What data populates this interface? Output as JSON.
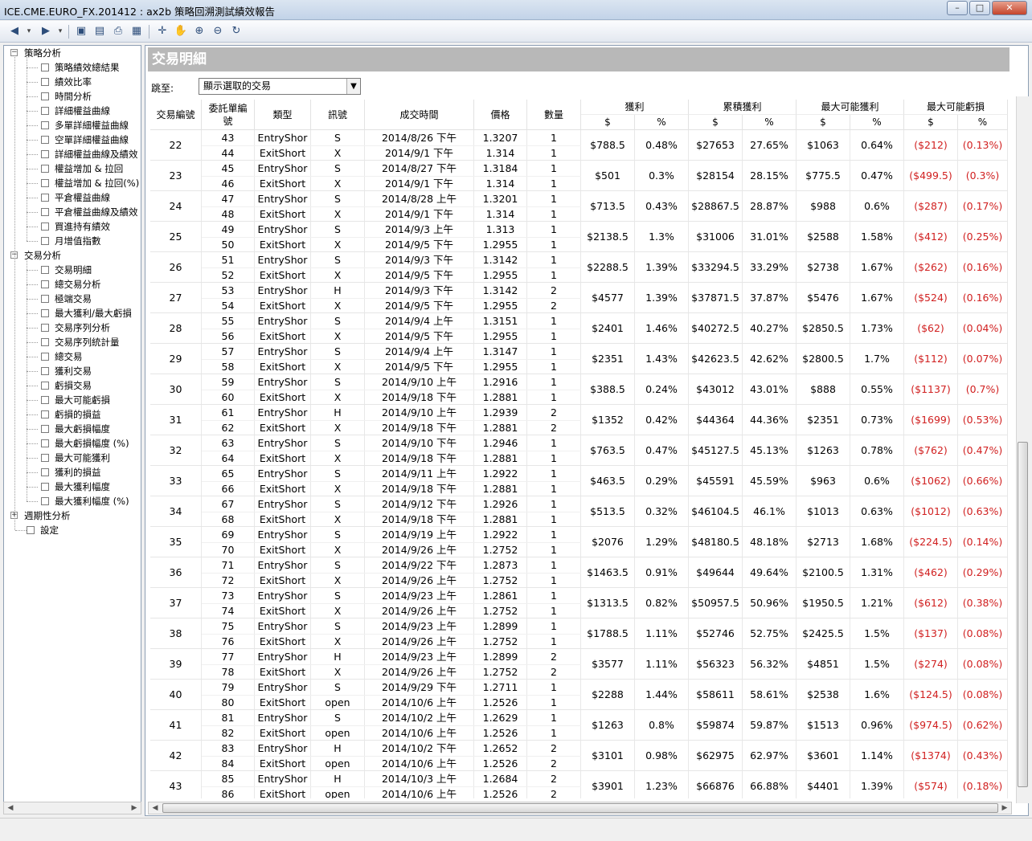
{
  "window": {
    "title": "ICE.CME.EURO_FX.201412 : ax2b 策略回溯測試績效報告",
    "minimize_glyph": "–",
    "maximize_glyph": "□",
    "close_glyph": "✕"
  },
  "toolbar": {
    "icons": [
      "back-icon",
      "dropdown-arrow-icon",
      "forward-icon",
      "dropdown-arrow-icon",
      "save-icon",
      "export-icon",
      "print-icon",
      "preview-icon",
      "crosshair-icon",
      "hand-pan-icon",
      "zoom-in-icon",
      "zoom-out-icon",
      "refresh-icon"
    ],
    "glyphs": {
      "back": "◀",
      "forward": "▶",
      "dropdown": "▾",
      "save": "▣",
      "export": "▤",
      "print": "⎙",
      "preview": "▦",
      "crosshair": "✛",
      "hand": "✋",
      "zoomin": "⊕",
      "zoomout": "⊖",
      "refresh": "↻"
    }
  },
  "tree": {
    "groups": [
      {
        "label": "策略分析",
        "toggle": "−",
        "items": [
          "策略績效總結果",
          "績效比率",
          "時間分析",
          "詳細權益曲線",
          "多單詳細權益曲線",
          "空單詳細權益曲線",
          "詳細權益曲線及績效",
          "權益增加 & 拉回",
          "權益增加 & 拉回(%)",
          "平倉權益曲線",
          "平倉權益曲線及績效",
          "買進持有績效",
          "月增值指數"
        ]
      },
      {
        "label": "交易分析",
        "toggle": "−",
        "items": [
          "交易明細",
          "總交易分析",
          "極端交易",
          "最大獲利/最大虧損",
          "交易序列分析",
          "交易序列統計量",
          "總交易",
          "獲利交易",
          "虧損交易",
          "最大可能虧損",
          "虧損的損益",
          "最大虧損幅度",
          "最大虧損幅度 (%)",
          "最大可能獲利",
          "獲利的損益",
          "最大獲利幅度",
          "最大獲利幅度 (%)"
        ]
      },
      {
        "label": "週期性分析",
        "toggle": "+",
        "items": []
      }
    ],
    "settings_label": "設定"
  },
  "main": {
    "header": "交易明細",
    "jump_label": "跳至:",
    "jump_value": "顯示選取的交易",
    "columns": {
      "trade_no": "交易編號",
      "order_no_1": "委託單編",
      "order_no_2": "號",
      "type": "類型",
      "signal": "訊號",
      "time": "成交時間",
      "price": "價格",
      "qty": "數量",
      "profit": "獲利",
      "cum_profit": "累積獲利",
      "max_profit": "最大可能獲利",
      "max_loss": "最大可能虧損",
      "dollar": "$",
      "percent": "%"
    },
    "trades": [
      {
        "no": "22",
        "e_ord": "43",
        "e_type": "EntryShor",
        "e_sig": "S",
        "e_time": "2014/8/26 下午",
        "e_price": "1.3207",
        "e_qty": "1",
        "x_ord": "44",
        "x_type": "ExitShort",
        "x_sig": "X",
        "x_time": "2014/9/1 下午",
        "x_price": "1.314",
        "x_qty": "1",
        "p": "$788.5",
        "pp": "0.48%",
        "c": "$27653",
        "cp": "27.65%",
        "mp": "$1063",
        "mpp": "0.64%",
        "ml": "($212)",
        "mlp": "(0.13%)"
      },
      {
        "no": "23",
        "e_ord": "45",
        "e_type": "EntryShor",
        "e_sig": "S",
        "e_time": "2014/8/27 下午",
        "e_price": "1.3184",
        "e_qty": "1",
        "x_ord": "46",
        "x_type": "ExitShort",
        "x_sig": "X",
        "x_time": "2014/9/1 下午",
        "x_price": "1.314",
        "x_qty": "1",
        "p": "$501",
        "pp": "0.3%",
        "c": "$28154",
        "cp": "28.15%",
        "mp": "$775.5",
        "mpp": "0.47%",
        "ml": "($499.5)",
        "mlp": "(0.3%)"
      },
      {
        "no": "24",
        "e_ord": "47",
        "e_type": "EntryShor",
        "e_sig": "S",
        "e_time": "2014/8/28 上午",
        "e_price": "1.3201",
        "e_qty": "1",
        "x_ord": "48",
        "x_type": "ExitShort",
        "x_sig": "X",
        "x_time": "2014/9/1 下午",
        "x_price": "1.314",
        "x_qty": "1",
        "p": "$713.5",
        "pp": "0.43%",
        "c": "$28867.5",
        "cp": "28.87%",
        "mp": "$988",
        "mpp": "0.6%",
        "ml": "($287)",
        "mlp": "(0.17%)"
      },
      {
        "no": "25",
        "e_ord": "49",
        "e_type": "EntryShor",
        "e_sig": "S",
        "e_time": "2014/9/3 上午",
        "e_price": "1.313",
        "e_qty": "1",
        "x_ord": "50",
        "x_type": "ExitShort",
        "x_sig": "X",
        "x_time": "2014/9/5 下午",
        "x_price": "1.2955",
        "x_qty": "1",
        "p": "$2138.5",
        "pp": "1.3%",
        "c": "$31006",
        "cp": "31.01%",
        "mp": "$2588",
        "mpp": "1.58%",
        "ml": "($412)",
        "mlp": "(0.25%)"
      },
      {
        "no": "26",
        "e_ord": "51",
        "e_type": "EntryShor",
        "e_sig": "S",
        "e_time": "2014/9/3 下午",
        "e_price": "1.3142",
        "e_qty": "1",
        "x_ord": "52",
        "x_type": "ExitShort",
        "x_sig": "X",
        "x_time": "2014/9/5 下午",
        "x_price": "1.2955",
        "x_qty": "1",
        "p": "$2288.5",
        "pp": "1.39%",
        "c": "$33294.5",
        "cp": "33.29%",
        "mp": "$2738",
        "mpp": "1.67%",
        "ml": "($262)",
        "mlp": "(0.16%)"
      },
      {
        "no": "27",
        "e_ord": "53",
        "e_type": "EntryShor",
        "e_sig": "H",
        "e_time": "2014/9/3 下午",
        "e_price": "1.3142",
        "e_qty": "2",
        "x_ord": "54",
        "x_type": "ExitShort",
        "x_sig": "X",
        "x_time": "2014/9/5 下午",
        "x_price": "1.2955",
        "x_qty": "2",
        "p": "$4577",
        "pp": "1.39%",
        "c": "$37871.5",
        "cp": "37.87%",
        "mp": "$5476",
        "mpp": "1.67%",
        "ml": "($524)",
        "mlp": "(0.16%)"
      },
      {
        "no": "28",
        "e_ord": "55",
        "e_type": "EntryShor",
        "e_sig": "S",
        "e_time": "2014/9/4 上午",
        "e_price": "1.3151",
        "e_qty": "1",
        "x_ord": "56",
        "x_type": "ExitShort",
        "x_sig": "X",
        "x_time": "2014/9/5 下午",
        "x_price": "1.2955",
        "x_qty": "1",
        "p": "$2401",
        "pp": "1.46%",
        "c": "$40272.5",
        "cp": "40.27%",
        "mp": "$2850.5",
        "mpp": "1.73%",
        "ml": "($62)",
        "mlp": "(0.04%)"
      },
      {
        "no": "29",
        "e_ord": "57",
        "e_type": "EntryShor",
        "e_sig": "S",
        "e_time": "2014/9/4 上午",
        "e_price": "1.3147",
        "e_qty": "1",
        "x_ord": "58",
        "x_type": "ExitShort",
        "x_sig": "X",
        "x_time": "2014/9/5 下午",
        "x_price": "1.2955",
        "x_qty": "1",
        "p": "$2351",
        "pp": "1.43%",
        "c": "$42623.5",
        "cp": "42.62%",
        "mp": "$2800.5",
        "mpp": "1.7%",
        "ml": "($112)",
        "mlp": "(0.07%)"
      },
      {
        "no": "30",
        "e_ord": "59",
        "e_type": "EntryShor",
        "e_sig": "S",
        "e_time": "2014/9/10 上午",
        "e_price": "1.2916",
        "e_qty": "1",
        "x_ord": "60",
        "x_type": "ExitShort",
        "x_sig": "X",
        "x_time": "2014/9/18 下午",
        "x_price": "1.2881",
        "x_qty": "1",
        "p": "$388.5",
        "pp": "0.24%",
        "c": "$43012",
        "cp": "43.01%",
        "mp": "$888",
        "mpp": "0.55%",
        "ml": "($1137)",
        "mlp": "(0.7%)"
      },
      {
        "no": "31",
        "e_ord": "61",
        "e_type": "EntryShor",
        "e_sig": "H",
        "e_time": "2014/9/10 上午",
        "e_price": "1.2939",
        "e_qty": "2",
        "x_ord": "62",
        "x_type": "ExitShort",
        "x_sig": "X",
        "x_time": "2014/9/18 下午",
        "x_price": "1.2881",
        "x_qty": "2",
        "p": "$1352",
        "pp": "0.42%",
        "c": "$44364",
        "cp": "44.36%",
        "mp": "$2351",
        "mpp": "0.73%",
        "ml": "($1699)",
        "mlp": "(0.53%)"
      },
      {
        "no": "32",
        "e_ord": "63",
        "e_type": "EntryShor",
        "e_sig": "S",
        "e_time": "2014/9/10 下午",
        "e_price": "1.2946",
        "e_qty": "1",
        "x_ord": "64",
        "x_type": "ExitShort",
        "x_sig": "X",
        "x_time": "2014/9/18 下午",
        "x_price": "1.2881",
        "x_qty": "1",
        "p": "$763.5",
        "pp": "0.47%",
        "c": "$45127.5",
        "cp": "45.13%",
        "mp": "$1263",
        "mpp": "0.78%",
        "ml": "($762)",
        "mlp": "(0.47%)"
      },
      {
        "no": "33",
        "e_ord": "65",
        "e_type": "EntryShor",
        "e_sig": "S",
        "e_time": "2014/9/11 上午",
        "e_price": "1.2922",
        "e_qty": "1",
        "x_ord": "66",
        "x_type": "ExitShort",
        "x_sig": "X",
        "x_time": "2014/9/18 下午",
        "x_price": "1.2881",
        "x_qty": "1",
        "p": "$463.5",
        "pp": "0.29%",
        "c": "$45591",
        "cp": "45.59%",
        "mp": "$963",
        "mpp": "0.6%",
        "ml": "($1062)",
        "mlp": "(0.66%)"
      },
      {
        "no": "34",
        "e_ord": "67",
        "e_type": "EntryShor",
        "e_sig": "S",
        "e_time": "2014/9/12 下午",
        "e_price": "1.2926",
        "e_qty": "1",
        "x_ord": "68",
        "x_type": "ExitShort",
        "x_sig": "X",
        "x_time": "2014/9/18 下午",
        "x_price": "1.2881",
        "x_qty": "1",
        "p": "$513.5",
        "pp": "0.32%",
        "c": "$46104.5",
        "cp": "46.1%",
        "mp": "$1013",
        "mpp": "0.63%",
        "ml": "($1012)",
        "mlp": "(0.63%)"
      },
      {
        "no": "35",
        "e_ord": "69",
        "e_type": "EntryShor",
        "e_sig": "S",
        "e_time": "2014/9/19 上午",
        "e_price": "1.2922",
        "e_qty": "1",
        "x_ord": "70",
        "x_type": "ExitShort",
        "x_sig": "X",
        "x_time": "2014/9/26 上午",
        "x_price": "1.2752",
        "x_qty": "1",
        "p": "$2076",
        "pp": "1.29%",
        "c": "$48180.5",
        "cp": "48.18%",
        "mp": "$2713",
        "mpp": "1.68%",
        "ml": "($224.5)",
        "mlp": "(0.14%)"
      },
      {
        "no": "36",
        "e_ord": "71",
        "e_type": "EntryShor",
        "e_sig": "S",
        "e_time": "2014/9/22 下午",
        "e_price": "1.2873",
        "e_qty": "1",
        "x_ord": "72",
        "x_type": "ExitShort",
        "x_sig": "X",
        "x_time": "2014/9/26 上午",
        "x_price": "1.2752",
        "x_qty": "1",
        "p": "$1463.5",
        "pp": "0.91%",
        "c": "$49644",
        "cp": "49.64%",
        "mp": "$2100.5",
        "mpp": "1.31%",
        "ml": "($462)",
        "mlp": "(0.29%)"
      },
      {
        "no": "37",
        "e_ord": "73",
        "e_type": "EntryShor",
        "e_sig": "S",
        "e_time": "2014/9/23 上午",
        "e_price": "1.2861",
        "e_qty": "1",
        "x_ord": "74",
        "x_type": "ExitShort",
        "x_sig": "X",
        "x_time": "2014/9/26 上午",
        "x_price": "1.2752",
        "x_qty": "1",
        "p": "$1313.5",
        "pp": "0.82%",
        "c": "$50957.5",
        "cp": "50.96%",
        "mp": "$1950.5",
        "mpp": "1.21%",
        "ml": "($612)",
        "mlp": "(0.38%)"
      },
      {
        "no": "38",
        "e_ord": "75",
        "e_type": "EntryShor",
        "e_sig": "S",
        "e_time": "2014/9/23 上午",
        "e_price": "1.2899",
        "e_qty": "1",
        "x_ord": "76",
        "x_type": "ExitShort",
        "x_sig": "X",
        "x_time": "2014/9/26 上午",
        "x_price": "1.2752",
        "x_qty": "1",
        "p": "$1788.5",
        "pp": "1.11%",
        "c": "$52746",
        "cp": "52.75%",
        "mp": "$2425.5",
        "mpp": "1.5%",
        "ml": "($137)",
        "mlp": "(0.08%)"
      },
      {
        "no": "39",
        "e_ord": "77",
        "e_type": "EntryShor",
        "e_sig": "H",
        "e_time": "2014/9/23 上午",
        "e_price": "1.2899",
        "e_qty": "2",
        "x_ord": "78",
        "x_type": "ExitShort",
        "x_sig": "X",
        "x_time": "2014/9/26 上午",
        "x_price": "1.2752",
        "x_qty": "2",
        "p": "$3577",
        "pp": "1.11%",
        "c": "$56323",
        "cp": "56.32%",
        "mp": "$4851",
        "mpp": "1.5%",
        "ml": "($274)",
        "mlp": "(0.08%)"
      },
      {
        "no": "40",
        "e_ord": "79",
        "e_type": "EntryShor",
        "e_sig": "S",
        "e_time": "2014/9/29 下午",
        "e_price": "1.2711",
        "e_qty": "1",
        "x_ord": "80",
        "x_type": "ExitShort",
        "x_sig": "open",
        "x_time": "2014/10/6 上午",
        "x_price": "1.2526",
        "x_qty": "1",
        "p": "$2288",
        "pp": "1.44%",
        "c": "$58611",
        "cp": "58.61%",
        "mp": "$2538",
        "mpp": "1.6%",
        "ml": "($124.5)",
        "mlp": "(0.08%)"
      },
      {
        "no": "41",
        "e_ord": "81",
        "e_type": "EntryShor",
        "e_sig": "S",
        "e_time": "2014/10/2 上午",
        "e_price": "1.2629",
        "e_qty": "1",
        "x_ord": "82",
        "x_type": "ExitShort",
        "x_sig": "open",
        "x_time": "2014/10/6 上午",
        "x_price": "1.2526",
        "x_qty": "1",
        "p": "$1263",
        "pp": "0.8%",
        "c": "$59874",
        "cp": "59.87%",
        "mp": "$1513",
        "mpp": "0.96%",
        "ml": "($974.5)",
        "mlp": "(0.62%)"
      },
      {
        "no": "42",
        "e_ord": "83",
        "e_type": "EntryShor",
        "e_sig": "H",
        "e_time": "2014/10/2 下午",
        "e_price": "1.2652",
        "e_qty": "2",
        "x_ord": "84",
        "x_type": "ExitShort",
        "x_sig": "open",
        "x_time": "2014/10/6 上午",
        "x_price": "1.2526",
        "x_qty": "2",
        "p": "$3101",
        "pp": "0.98%",
        "c": "$62975",
        "cp": "62.97%",
        "mp": "$3601",
        "mpp": "1.14%",
        "ml": "($1374)",
        "mlp": "(0.43%)"
      },
      {
        "no": "43",
        "e_ord": "85",
        "e_type": "EntryShor",
        "e_sig": "H",
        "e_time": "2014/10/3 上午",
        "e_price": "1.2684",
        "e_qty": "2",
        "x_ord": "86",
        "x_type": "ExitShort",
        "x_sig": "open",
        "x_time": "2014/10/6 上午",
        "x_price": "1.2526",
        "x_qty": "2",
        "p": "$3901",
        "pp": "1.23%",
        "c": "$66876",
        "cp": "66.88%",
        "mp": "$4401",
        "mpp": "1.39%",
        "ml": "($574)",
        "mlp": "(0.18%)"
      }
    ]
  },
  "colors": {
    "negative": "#d12020",
    "header_bar": "#b8b8b8"
  }
}
